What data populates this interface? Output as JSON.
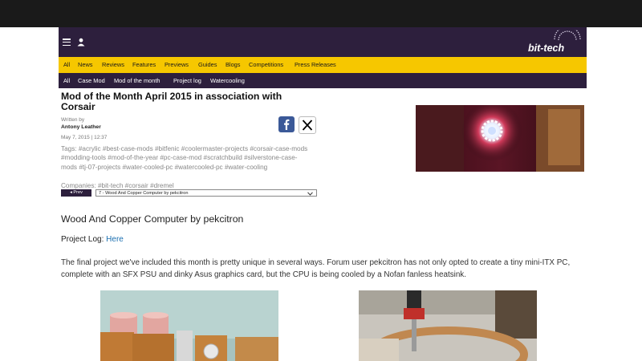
{
  "site": {
    "logo_text": "bit-tech"
  },
  "mainnav": [
    {
      "label": "All"
    },
    {
      "label": "News"
    },
    {
      "label": "Reviews"
    },
    {
      "label": "Features"
    },
    {
      "label": "Previews"
    },
    {
      "label": "Guides"
    },
    {
      "label": "Blogs"
    },
    {
      "label": "Competitions"
    },
    {
      "label": "Press Releases"
    }
  ],
  "subnav": [
    {
      "label": "All"
    },
    {
      "label": "Case Mod"
    },
    {
      "label": "Mod of the month"
    },
    {
      "label": "Project log"
    },
    {
      "label": "Watercooling"
    }
  ],
  "article": {
    "title": "Mod of the Month April 2015 in association with Corsair",
    "written_by": "Written by",
    "author": "Antony Leather",
    "date": "May 7, 2015 | 12:37",
    "tags_label": "Tags: ",
    "tags": [
      "#acrylic",
      "#best-case-mods",
      "#bitfenic",
      "#coolermaster-projects",
      "#corsair-case-mods",
      "#modding-tools",
      "#mod-of-the-year",
      "#pc-case-mod",
      "#scratchbuild",
      "#silverstone-case-mods",
      "#tj-07-projects",
      "#water-cooled-pc",
      "#watercooled-pc",
      "#water-cooling"
    ],
    "companies_label": "Companies: ",
    "companies": [
      "#bit-tech",
      "#corsair",
      "#dremel"
    ],
    "prev_label": "◂ Prev",
    "page_select": "7 - Wood And Copper Computer by pekcitron",
    "heading": "Wood And Copper Computer by pekcitron",
    "project_log_label": "Project Log: ",
    "project_log_link": "Here",
    "body": "The final project we've included this month is pretty unique in several ways. Forum user pekcitron has not only opted to create a tiny mini-ITX PC, complete with an SFX PSU and dinky Asus graphics card, but the CPU is being cooled by a Nofan fanless heatsink."
  },
  "colors": {
    "header_bg": "#2d1f3d",
    "nav_yellow": "#f6c700",
    "link_blue": "#1a6fb0",
    "facebook_blue": "#3b5998"
  },
  "icons": [
    "hamburger-icon",
    "user-icon",
    "facebook-icon",
    "x-icon",
    "chevron-down-icon"
  ]
}
